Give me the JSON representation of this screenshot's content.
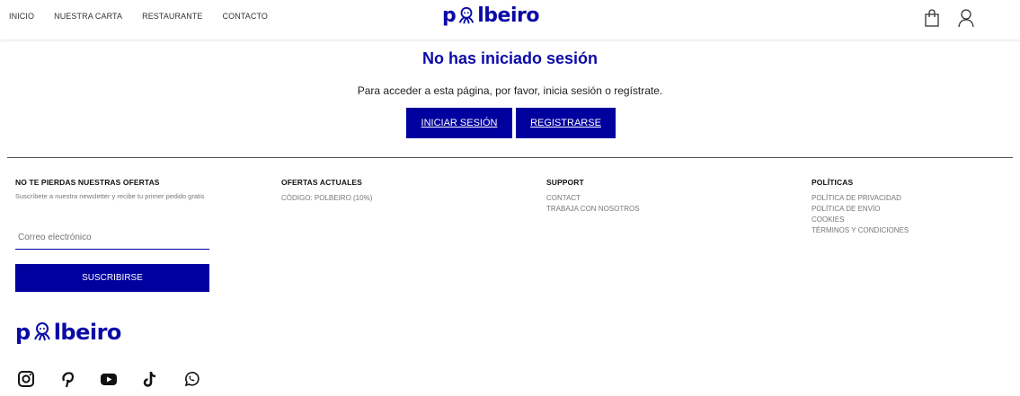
{
  "header": {
    "nav": [
      "INICIO",
      "NUESTRA CARTA",
      "RESTAURANTE",
      "CONTACTO"
    ],
    "logo_left": "p",
    "logo_right": "lbeiro",
    "icons": [
      "bag-icon",
      "user-icon"
    ]
  },
  "main": {
    "title": "No has iniciado sesión",
    "message": "Para acceder a esta página, por favor, inicia sesión o regístrate.",
    "login_label": "INICIAR SESIÓN",
    "register_label": "REGISTRARSE"
  },
  "footer": {
    "newsletter": {
      "heading": "NO TE PIERDAS NUESTRAS OFERTAS",
      "text": "Suscríbete a nuestra newsletter y recibe tu primer pedido gratis",
      "email_placeholder": "Correo electrónico",
      "subscribe_label": "SUSCRIBIRSE"
    },
    "offers": {
      "heading": "OFERTAS ACTUALES",
      "items": [
        "CÓDIGO: POLBEIRO (10%)"
      ]
    },
    "support": {
      "heading": "SUPPORT",
      "items": [
        "CONTACT",
        "TRABAJA CON NOSOTROS"
      ]
    },
    "policies": {
      "heading": "POLÍTICAS",
      "items": [
        "POLÍTICA DE PRIVACIDAD",
        "POLÍTICA DE ENVÍO",
        "COOKIES",
        "TÉRMINOS Y CONDICIONES"
      ]
    },
    "logo_left": "p",
    "logo_right": "lbeiro",
    "social": [
      "instagram-icon",
      "pinterest-icon",
      "youtube-icon",
      "tiktok-icon",
      "whatsapp-icon"
    ]
  },
  "colors": {
    "brand": "#0a0aa6",
    "button": "#00009e"
  }
}
